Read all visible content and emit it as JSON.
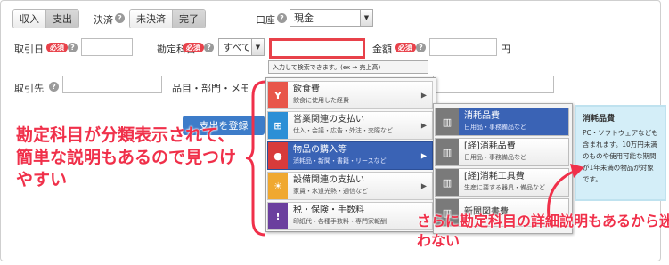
{
  "toggles": {
    "income": "収入",
    "expense": "支出",
    "settlement_label": "決済",
    "unsettled": "未決済",
    "settled": "完了"
  },
  "account": {
    "label": "口座",
    "value": "現金"
  },
  "row2": {
    "date_label": "取引日",
    "required": "必須",
    "category_label": "勘定科目",
    "category_select": "すべて",
    "amount_label": "金額",
    "yen": "円"
  },
  "search_hint": "入力して検索できます。(ex → 売上高)",
  "row3": {
    "partner_label": "取引先",
    "item_label": "品目・部門・メモタグ"
  },
  "register_button": "支出を登録",
  "category_menu": [
    {
      "name": "飲食費",
      "desc": "飲食に使用した経費",
      "color": "#e8564a",
      "icon": "glass-icon",
      "glyph": "Y"
    },
    {
      "name": "営業関連の支払い",
      "desc": "仕入・会議・広告・外注・交際など",
      "color": "#2c8fd6",
      "icon": "cart-icon",
      "glyph": "⊞"
    },
    {
      "name": "物品の購入等",
      "desc": "消耗品・新聞・書籍・リースなど",
      "color": "#d83b3b",
      "icon": "drop-icon",
      "glyph": "●",
      "selected": true
    },
    {
      "name": "設備関連の支払い",
      "desc": "家賃・水道光熱・通信など",
      "color": "#f0a830",
      "icon": "lightbulb-icon",
      "glyph": "☀"
    },
    {
      "name": "税・保険・手数料",
      "desc": "印紙代・各種手数料・専門家報酬",
      "color": "#6b3f9e",
      "icon": "warning-icon",
      "glyph": "!"
    }
  ],
  "sub_menu": [
    {
      "name": "消耗品費",
      "desc": "日用品・事務備品など",
      "selected": true
    },
    {
      "name": "[経]消耗品費",
      "desc": "日用品・事務備品など"
    },
    {
      "name": "[経]消耗工具費",
      "desc": "生産に要する器具・備品など"
    },
    {
      "name": "新聞図書費",
      "desc": ""
    }
  ],
  "detail": {
    "title": "消耗品費",
    "body": "PC・ソフトウェアなども含まれます。10万円未満のものや使用可能な期間が1年未満の物品が対象です。"
  },
  "annotations": {
    "left": "勘定科目が分類表示されて、簡単な説明もあるので見つけやすい",
    "bottom": "さらに勘定科目の詳細説明もあるから迷わない",
    "color": "#f0304a"
  }
}
